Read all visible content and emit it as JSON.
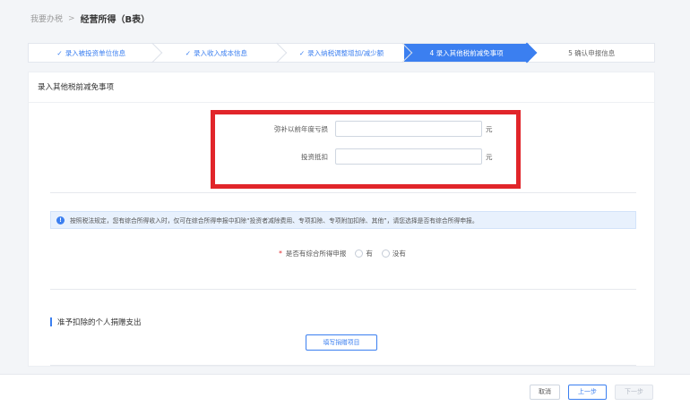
{
  "breadcrumb": {
    "root": "我要办税",
    "separator": ">",
    "current": "经营所得（B表）"
  },
  "steps": [
    {
      "label": "录入被投资单位信息",
      "done": true,
      "active": false
    },
    {
      "label": "录入收入成本信息",
      "done": true,
      "active": false
    },
    {
      "label": "录入纳税调整增加/减少额",
      "done": true,
      "active": false
    },
    {
      "label": "4 录入其他税前减免事项",
      "done": false,
      "active": true
    },
    {
      "label": "5 确认申报信息",
      "done": false,
      "active": false
    }
  ],
  "card": {
    "title": "录入其他税前减免事项"
  },
  "form": {
    "loss_label": "弥补以前年度亏损",
    "loss_value": "",
    "loss_unit": "元",
    "invest_label": "投资抵扣",
    "invest_value": "",
    "invest_unit": "元"
  },
  "notice": {
    "text": "按照税法规定，您有综合所得收入时，仅可在综合所得申报中扣除“投资者减除费用、专项扣除、专项附加扣除、其他”，请您选择是否有综合所得申报。"
  },
  "comprehensive": {
    "required_mark": "*",
    "label": "是否有综合所得申报",
    "option_yes": "有",
    "option_no": "没有"
  },
  "donation": {
    "section_title": "准予扣除的个人捐赠支出",
    "fill_button": "填写捐赠项目"
  },
  "footer": {
    "cancel": "取消",
    "prev": "上一步",
    "next": "下一步"
  },
  "colors": {
    "accent": "#3b7ff0",
    "highlight": "#e1252a"
  }
}
